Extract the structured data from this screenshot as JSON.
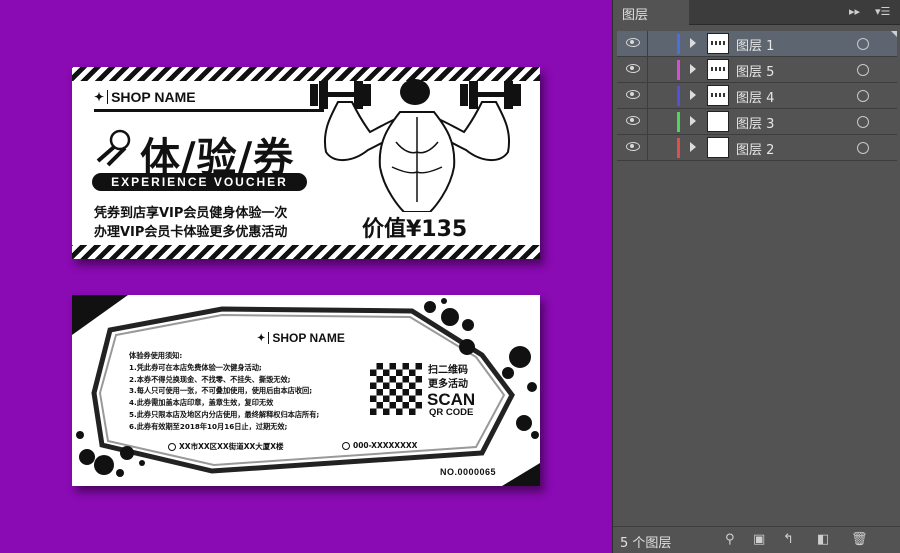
{
  "canvas": {
    "front_card": {
      "shop_logo": "✦",
      "shop_name": "SHOP NAME",
      "title": "体/验/券",
      "subtitle": "EXPERIENCE VOUCHER",
      "line1": "凭券到店享VIP会员健身体验一次",
      "line2": "办理VIP会员卡体验更多优惠活动",
      "price": "价值¥135"
    },
    "back_card": {
      "shop_name": "SHOP NAME",
      "rules_title": "体验券使用须知:",
      "rules": [
        "1.凭此券可在本店免费体验一次健身活动;",
        "2.本券不得兑换现金、不找零、不挂失、撕毁无效;",
        "3.每人只可使用一张，不可叠加使用，使用后由本店收回;",
        "4.此券需加盖本店印章，盖章生效，复印无效",
        "5.此券只限本店及地区内分店使用，最终解释权归本店所有;",
        "6.此券有效期至2018年10月16日止，过期无效;"
      ],
      "scan_cn1": "扫二维码",
      "scan_cn2": "更多活动",
      "scan_en": "SCAN",
      "qr_code_label": "QR CODE",
      "address": "XX市XX区XX街道XX大厦X楼",
      "phone": "000-XXXXXXXX",
      "serial": "NO.0000065"
    }
  },
  "panel": {
    "tab_title": "图层",
    "layers": [
      {
        "name": "图层 1",
        "color": "#4a6fe3",
        "selected": true,
        "thumb": "art"
      },
      {
        "name": "图层 5",
        "color": "#d24fd6",
        "selected": false,
        "thumb": "art"
      },
      {
        "name": "图层 4",
        "color": "#4f52e0",
        "selected": false,
        "thumb": "art"
      },
      {
        "name": "图层 3",
        "color": "#4fd65a",
        "selected": false,
        "thumb": "blank"
      },
      {
        "name": "图层 2",
        "color": "#e04f4f",
        "selected": false,
        "thumb": "blank"
      }
    ],
    "footer_count": "5 个图层",
    "colors": {
      "panel_bg": "#535353",
      "canvas_bg": "#8a0ab3"
    }
  }
}
